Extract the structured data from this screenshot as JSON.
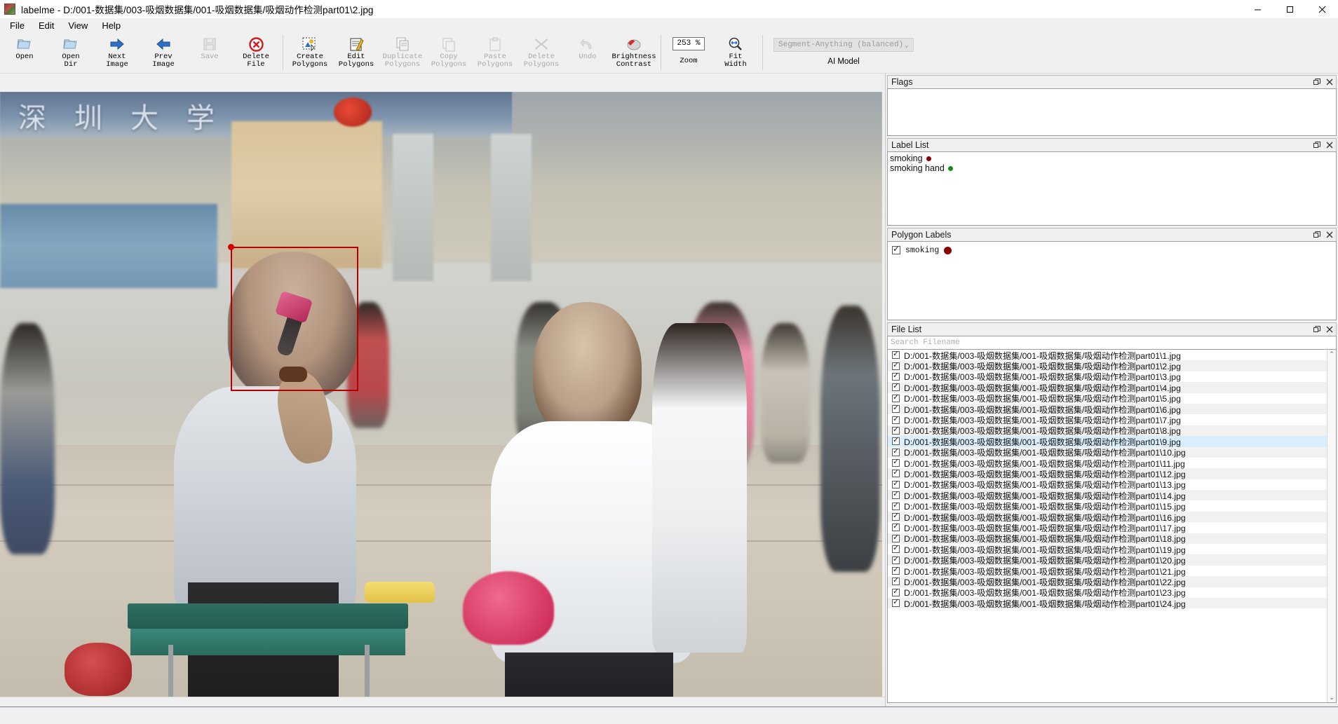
{
  "window": {
    "app_name": "labelme",
    "title": "labelme - D:/001-数据集/003-吸烟数据集/001-吸烟数据集/吸烟动作检测part01\\2.jpg",
    "minimize": "—",
    "maximize": "☐",
    "close": "✕"
  },
  "menubar": {
    "items": [
      {
        "label": "File"
      },
      {
        "label": "Edit"
      },
      {
        "label": "View"
      },
      {
        "label": "Help"
      }
    ]
  },
  "toolbar": {
    "buttons": [
      {
        "label": "Open",
        "icon": "open-folder-icon",
        "enabled": true
      },
      {
        "label": "Open\nDir",
        "icon": "open-dir-icon",
        "enabled": true
      },
      {
        "label": "Next\nImage",
        "icon": "arrow-right-icon",
        "enabled": true
      },
      {
        "label": "Prev\nImage",
        "icon": "arrow-left-icon",
        "enabled": true
      },
      {
        "label": "Save",
        "icon": "floppy-save-icon",
        "enabled": false
      },
      {
        "label": "Delete\nFile",
        "icon": "delete-circle-icon",
        "enabled": true
      },
      {
        "label": "Create\nPolygons",
        "icon": "create-polygon-icon",
        "enabled": true
      },
      {
        "label": "Edit\nPolygons",
        "icon": "edit-pencil-icon",
        "enabled": true
      },
      {
        "label": "Duplicate\nPolygons",
        "icon": "duplicate-icon",
        "enabled": false
      },
      {
        "label": "Copy\nPolygons",
        "icon": "copy-icon",
        "enabled": false
      },
      {
        "label": "Paste\nPolygons",
        "icon": "paste-icon",
        "enabled": false
      },
      {
        "label": "Delete\nPolygons",
        "icon": "x-cross-icon",
        "enabled": false
      },
      {
        "label": "Undo",
        "icon": "undo-arrow-icon",
        "enabled": false
      },
      {
        "label": "Brightness\nContrast",
        "icon": "brightness-icon",
        "enabled": true
      }
    ],
    "zoom": {
      "value": "253 %",
      "label": "Zoom"
    },
    "fit_width": {
      "label": "Fit\nWidth",
      "icon": "fit-width-icon"
    },
    "ai_model": {
      "selected": "Segment-Anything (balanced)",
      "label": "AI Model",
      "chevron": "⌄"
    }
  },
  "panels": {
    "flags": {
      "title": "Flags",
      "float_icon": "float-icon",
      "close_icon": "close-icon",
      "items": []
    },
    "label_list": {
      "title": "Label List",
      "float_icon": "float-icon",
      "close_icon": "close-icon",
      "items": [
        {
          "label": "smoking",
          "color": "#8b0000"
        },
        {
          "label": "smoking hand",
          "color": "#1a8a1a"
        }
      ]
    },
    "polygon_labels": {
      "title": "Polygon Labels",
      "float_icon": "float-icon",
      "close_icon": "close-icon",
      "items": [
        {
          "label": "smoking",
          "color": "#8b0000",
          "checked": true
        }
      ]
    },
    "file_list": {
      "title": "File List",
      "float_icon": "float-icon",
      "close_icon": "close-icon",
      "search_placeholder": "Search Filename",
      "search_value": "",
      "prefix": "D:/001-数据集/003-吸烟数据集/001-吸烟数据集/吸烟动作检测part01\\",
      "selected_index": 8,
      "files": [
        {
          "name": "D:/001-数据集/003-吸烟数据集/001-吸烟数据集/吸烟动作检测part01\\1.jpg",
          "checked": true
        },
        {
          "name": "D:/001-数据集/003-吸烟数据集/001-吸烟数据集/吸烟动作检测part01\\2.jpg",
          "checked": true
        },
        {
          "name": "D:/001-数据集/003-吸烟数据集/001-吸烟数据集/吸烟动作检测part01\\3.jpg",
          "checked": true
        },
        {
          "name": "D:/001-数据集/003-吸烟数据集/001-吸烟数据集/吸烟动作检测part01\\4.jpg",
          "checked": true
        },
        {
          "name": "D:/001-数据集/003-吸烟数据集/001-吸烟数据集/吸烟动作检测part01\\5.jpg",
          "checked": true
        },
        {
          "name": "D:/001-数据集/003-吸烟数据集/001-吸烟数据集/吸烟动作检测part01\\6.jpg",
          "checked": true
        },
        {
          "name": "D:/001-数据集/003-吸烟数据集/001-吸烟数据集/吸烟动作检测part01\\7.jpg",
          "checked": true
        },
        {
          "name": "D:/001-数据集/003-吸烟数据集/001-吸烟数据集/吸烟动作检测part01\\8.jpg",
          "checked": true
        },
        {
          "name": "D:/001-数据集/003-吸烟数据集/001-吸烟数据集/吸烟动作检测part01\\9.jpg",
          "checked": true
        },
        {
          "name": "D:/001-数据集/003-吸烟数据集/001-吸烟数据集/吸烟动作检测part01\\10.jpg",
          "checked": true
        },
        {
          "name": "D:/001-数据集/003-吸烟数据集/001-吸烟数据集/吸烟动作检测part01\\11.jpg",
          "checked": true
        },
        {
          "name": "D:/001-数据集/003-吸烟数据集/001-吸烟数据集/吸烟动作检测part01\\12.jpg",
          "checked": true
        },
        {
          "name": "D:/001-数据集/003-吸烟数据集/001-吸烟数据集/吸烟动作检测part01\\13.jpg",
          "checked": true
        },
        {
          "name": "D:/001-数据集/003-吸烟数据集/001-吸烟数据集/吸烟动作检测part01\\14.jpg",
          "checked": true
        },
        {
          "name": "D:/001-数据集/003-吸烟数据集/001-吸烟数据集/吸烟动作检测part01\\15.jpg",
          "checked": true
        },
        {
          "name": "D:/001-数据集/003-吸烟数据集/001-吸烟数据集/吸烟动作检测part01\\16.jpg",
          "checked": true
        },
        {
          "name": "D:/001-数据集/003-吸烟数据集/001-吸烟数据集/吸烟动作检测part01\\17.jpg",
          "checked": true
        },
        {
          "name": "D:/001-数据集/003-吸烟数据集/001-吸烟数据集/吸烟动作检测part01\\18.jpg",
          "checked": true
        },
        {
          "name": "D:/001-数据集/003-吸烟数据集/001-吸烟数据集/吸烟动作检测part01\\19.jpg",
          "checked": true
        },
        {
          "name": "D:/001-数据集/003-吸烟数据集/001-吸烟数据集/吸烟动作检测part01\\20.jpg",
          "checked": true
        },
        {
          "name": "D:/001-数据集/003-吸烟数据集/001-吸烟数据集/吸烟动作检测part01\\21.jpg",
          "checked": true
        },
        {
          "name": "D:/001-数据集/003-吸烟数据集/001-吸烟数据集/吸烟动作检测part01\\22.jpg",
          "checked": true
        },
        {
          "name": "D:/001-数据集/003-吸烟数据集/001-吸烟数据集/吸烟动作检测part01\\23.jpg",
          "checked": true
        },
        {
          "name": "D:/001-数据集/003-吸烟数据集/001-吸烟数据集/吸烟动作检测part01\\24.jpg",
          "checked": true
        }
      ],
      "scroll_up": "⌃",
      "scroll_down": "⌄"
    }
  },
  "canvas": {
    "annotation": {
      "label": "smoking",
      "color": "#b40000",
      "shape": "rectangle"
    },
    "scene_text": "深圳大学"
  }
}
